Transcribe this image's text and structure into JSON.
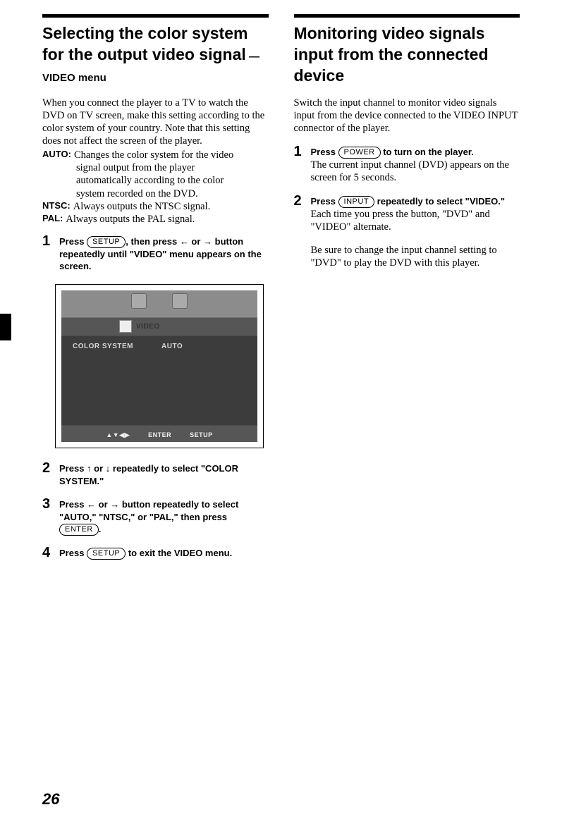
{
  "page_number": "26",
  "left": {
    "heading_line1": "Selecting the color system for the output video signal",
    "heading_sub": " —  VIDEO menu",
    "intro": "When you connect the player to a TV to watch the DVD on TV screen, make this setting according to the color system of your country. Note that this setting does not affect the screen of the player.",
    "opts": {
      "auto_label": "AUTO:",
      "auto_desc_l1": "Changes the color system for the video",
      "auto_desc_l2": "signal output from the player",
      "auto_desc_l3": "automatically according to the color",
      "auto_desc_l4": "system recorded on the DVD.",
      "ntsc_label": "NTSC:",
      "ntsc_desc": "Always outputs the NTSC signal.",
      "pal_label": "PAL:",
      "pal_desc": "Always outputs the PAL signal."
    },
    "steps": {
      "s1_a": "Press ",
      "s1_btn1": "SETUP",
      "s1_b": ", then press ",
      "s1_c": " or ",
      "s1_d": " button repeatedly until \"VIDEO\" menu appears on the screen.",
      "s2_a": "Press ",
      "s2_b": " or ",
      "s2_c": " repeatedly to select \"COLOR SYSTEM.\"",
      "s3_a": "Press  ",
      "s3_b": " or ",
      "s3_c": " button repeatedly to select \"AUTO,\" \"NTSC,\" or \"PAL,\" then press ",
      "s3_btn": "ENTER",
      "s3_d": ".",
      "s4_a": "Press ",
      "s4_btn": "SETUP",
      "s4_b": " to exit the VIDEO menu."
    },
    "screenshot": {
      "tab_label": "VIDEO",
      "menu_item": "COLOR SYSTEM",
      "menu_value": "AUTO",
      "hint_nav": "▲▼◀▶",
      "hint_enter": "ENTER",
      "hint_setup": "SETUP"
    }
  },
  "right": {
    "heading": "Monitoring video signals input from the connected device",
    "intro": "Switch the input channel to monitor video signals input from the device connected to the VIDEO INPUT connector of the player.",
    "steps": {
      "s1_a": "Press ",
      "s1_btn": "POWER",
      "s1_b": " to turn on the player.",
      "s1_body": "The current input channel (DVD) appears on the screen for 5 seconds.",
      "s2_a": "Press ",
      "s2_btn": "INPUT",
      "s2_b": " repeatedly to select \"VIDEO.\"",
      "s2_body1": "Each time you press the button, \"DVD\" and \"VIDEO\" alternate.",
      "s2_body2": "Be sure to change the input channel setting to \"DVD\" to play the DVD with this player."
    }
  },
  "arrows": {
    "left": "←",
    "right": "→",
    "up": "↑",
    "down": "↓"
  }
}
